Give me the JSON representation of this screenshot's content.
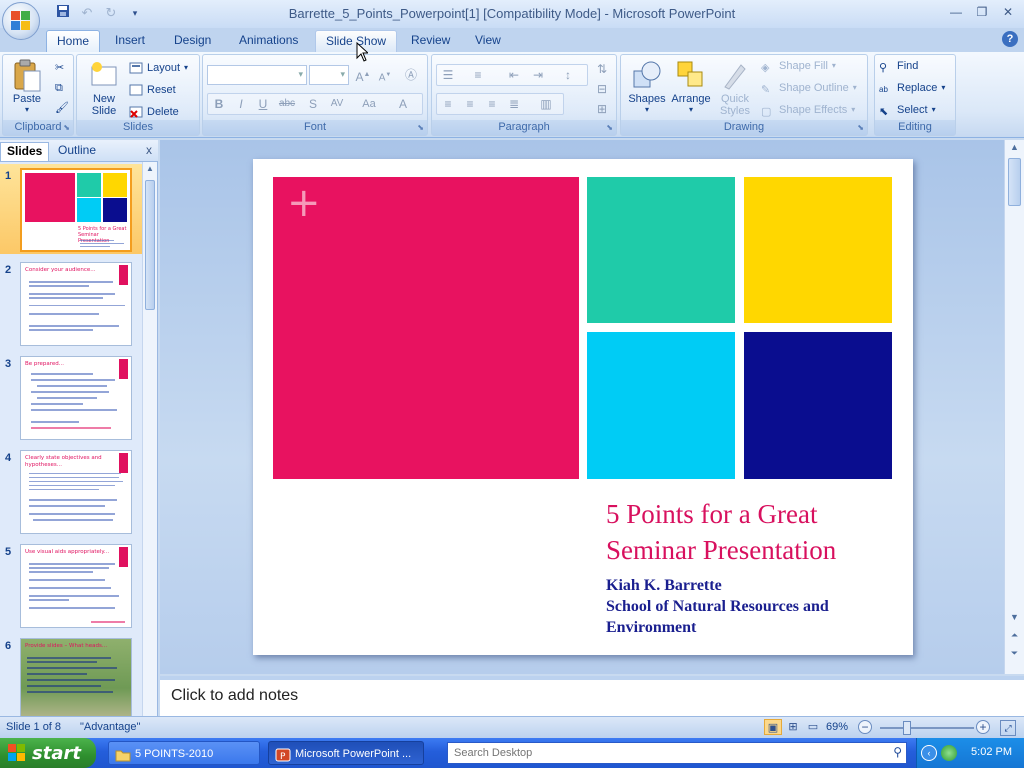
{
  "window": {
    "title": "Barrette_5_Points_Powerpoint[1] [Compatibility Mode] - Microsoft PowerPoint"
  },
  "qat": {
    "save_icon": "save-icon",
    "undo_icon": "undo-icon",
    "redo_icon": "redo-icon"
  },
  "tabs": [
    {
      "label": "Home",
      "state": "active"
    },
    {
      "label": "Insert"
    },
    {
      "label": "Design"
    },
    {
      "label": "Animations"
    },
    {
      "label": "Slide Show",
      "state": "hover"
    },
    {
      "label": "Review"
    },
    {
      "label": "View"
    }
  ],
  "ribbon": {
    "clipboard": {
      "label": "Clipboard",
      "paste": "Paste"
    },
    "slides": {
      "label": "Slides",
      "new_slide": "New Slide",
      "layout": "Layout",
      "reset": "Reset",
      "delete": "Delete"
    },
    "font": {
      "label": "Font"
    },
    "paragraph": {
      "label": "Paragraph"
    },
    "drawing": {
      "label": "Drawing",
      "shapes": "Shapes",
      "arrange": "Arrange",
      "quick_styles": "Quick Styles",
      "shape_fill": "Shape Fill",
      "shape_outline": "Shape Outline",
      "shape_effects": "Shape Effects"
    },
    "editing": {
      "label": "Editing",
      "find": "Find",
      "replace": "Replace",
      "select": "Select"
    }
  },
  "pane": {
    "tab_slides": "Slides",
    "tab_outline": "Outline",
    "close": "x",
    "thumbs": [
      {
        "num": "1",
        "title": "5 Points for a Great Seminar Presentation"
      },
      {
        "num": "2",
        "title": "Consider your audience..."
      },
      {
        "num": "3",
        "title": "Be prepared..."
      },
      {
        "num": "4",
        "title": "Clearly state objectives and hypotheses..."
      },
      {
        "num": "5",
        "title": "Use visual aids appropriately..."
      },
      {
        "num": "6",
        "title": "Provide slides – What heads..."
      }
    ]
  },
  "slide": {
    "title_line1": "5 Points for a Great",
    "title_line2": "Seminar Presentation",
    "author": "Kiah K. Barrette",
    "school_line1": "School of Natural Resources and",
    "school_line2": "Environment",
    "plus": "+",
    "colors": {
      "magenta": "#e81260",
      "teal": "#1fcba9",
      "yellow": "#ffd700",
      "cyan": "#00ccf5",
      "navy": "#0a0d8f"
    }
  },
  "notes": {
    "placeholder": "Click to add notes"
  },
  "status": {
    "slide_info": "Slide 1 of 8",
    "theme": "\"Advantage\"",
    "zoom": "69%"
  },
  "taskbar": {
    "start": "start",
    "task1": "5 POINTS-2010",
    "task2": "Microsoft PowerPoint ...",
    "search_placeholder": "Search Desktop",
    "clock": "5:02 PM"
  }
}
